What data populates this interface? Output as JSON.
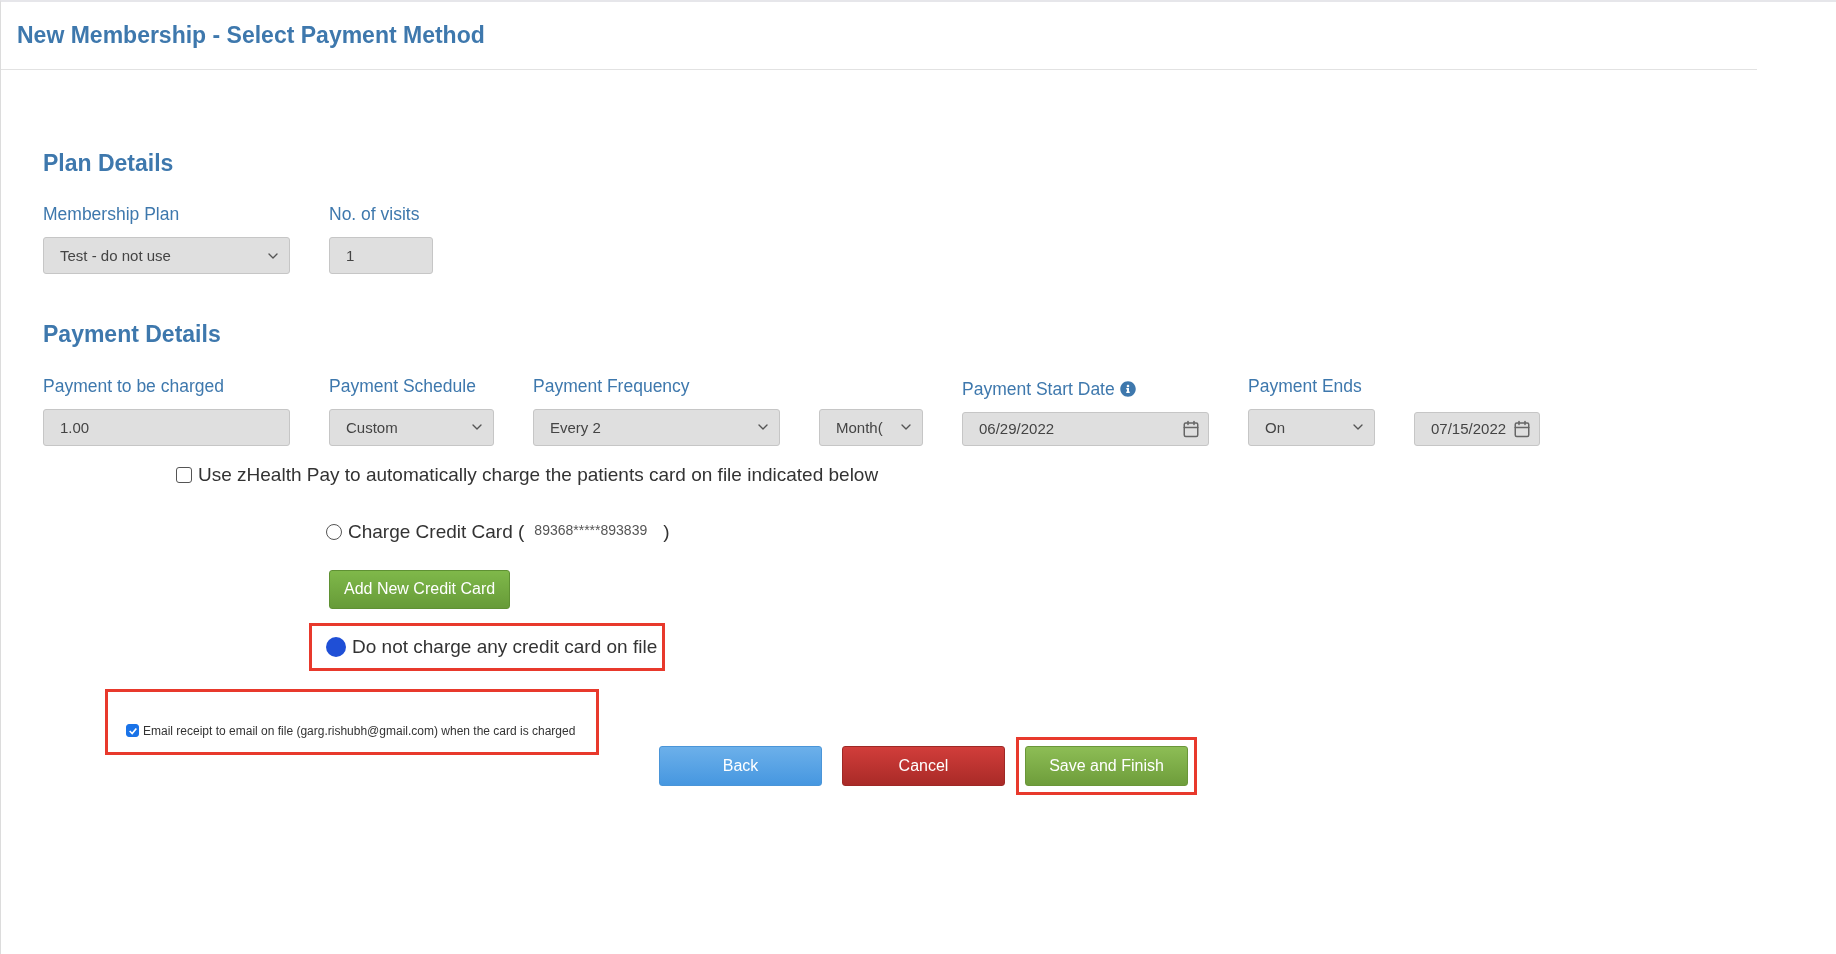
{
  "page_title": "New Membership - Select Payment Method",
  "plan_details": {
    "heading": "Plan Details",
    "fields": [
      {
        "kind": "select",
        "label": "Membership Plan",
        "value": "Test - do not use"
      },
      {
        "kind": "input",
        "label": "No. of visits",
        "value": "1"
      }
    ]
  },
  "payment_details": {
    "heading": "Payment Details",
    "fields": [
      {
        "kind": "input",
        "label": "Payment to be charged",
        "value": "1.00"
      },
      {
        "kind": "select",
        "label": "Payment Schedule",
        "value": "Custom"
      },
      {
        "kind": "select",
        "label": "Payment Frequency",
        "value": "Every 2"
      },
      {
        "kind": "select",
        "value": "Month("
      },
      {
        "kind": "date",
        "label": "Payment Start Date",
        "has_info": true,
        "value": "06/29/2022"
      },
      {
        "kind": "select",
        "label": "Payment Ends",
        "value": "On"
      },
      {
        "kind": "date",
        "value": "07/15/2022"
      }
    ]
  },
  "auto_charge": {
    "label": "Use zHealth Pay to automatically charge the patients card on file indicated below",
    "checked": false
  },
  "card_options": [
    {
      "kind": "radio",
      "label": "Charge Credit Card (",
      "card_number": "89368*****893839",
      "close": ")",
      "selected": false,
      "highlighted": false
    },
    {
      "kind": "button",
      "label": "Add New Credit Card"
    },
    {
      "kind": "radio",
      "label": "Do not charge any credit card on file",
      "selected": true,
      "highlighted": true
    }
  ],
  "email_receipt": {
    "label": "Email receipt to email on file (garg.rishubh@gmail.com) when the card is charged",
    "checked": true,
    "highlighted": true
  },
  "buttons": [
    {
      "kind": "back",
      "label": "Back",
      "highlighted": false
    },
    {
      "kind": "cancel",
      "label": "Cancel",
      "highlighted": false
    },
    {
      "kind": "save",
      "label": "Save and Finish",
      "highlighted": true
    }
  ]
}
